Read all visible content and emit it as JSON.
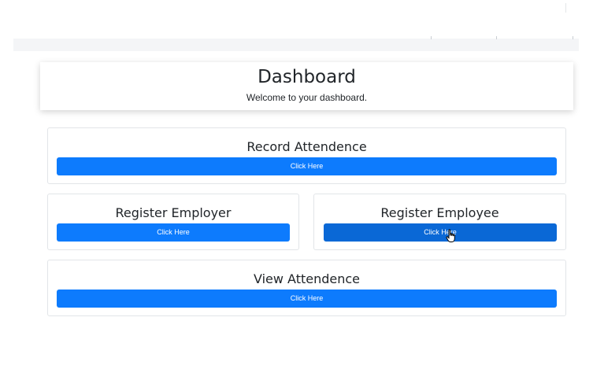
{
  "header": {
    "title": "Dashboard",
    "subtitle": "Welcome to your dashboard."
  },
  "cards": {
    "record_attendence": {
      "title": "Record Attendence",
      "button": "Click Here"
    },
    "register_employer": {
      "title": "Register Employer",
      "button": "Click Here"
    },
    "register_employee": {
      "title": "Register Employee",
      "button": "Click Here"
    },
    "view_attendence": {
      "title": "View Attendence",
      "button": "Click Here"
    }
  },
  "colors": {
    "button": "#0d7bfd",
    "button_hover": "#0a68d6"
  },
  "icons": {
    "cursor": "hand-pointer-icon"
  }
}
